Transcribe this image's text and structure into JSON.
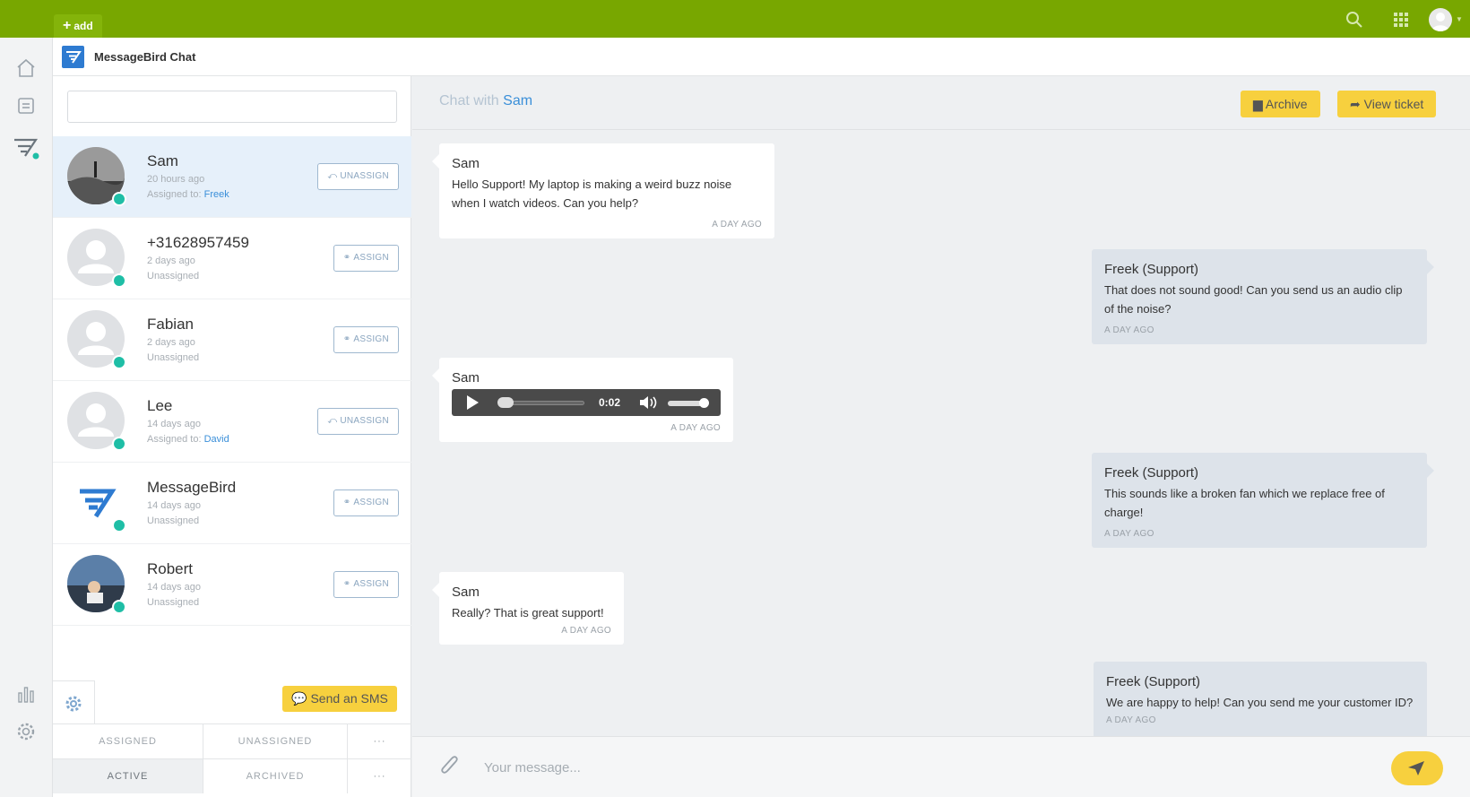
{
  "colors": {
    "topbar": "#78a700",
    "accent_yellow": "#f7d03e",
    "link_blue": "#3a8fd9",
    "online": "#1fbea6"
  },
  "topbar": {
    "add_label": "add",
    "search_icon": "search-icon",
    "apps_icon": "grid-icon",
    "user_icon": "avatar"
  },
  "leftnav": {
    "items": [
      "home-icon",
      "notes-icon",
      "chat-icon",
      "bar-chart-icon",
      "gear-icon"
    ]
  },
  "app": {
    "title": "MessageBird Chat"
  },
  "search": {
    "placeholder": ""
  },
  "conversations": [
    {
      "name": "Sam",
      "time": "20 hours ago",
      "assigned_prefix": "Assigned to:",
      "assigned_to": "Freek",
      "action": "UNASSIGN",
      "active": true
    },
    {
      "name": "+31628957459",
      "time": "2 days ago",
      "assigned_prefix": "Unassigned",
      "assigned_to": "",
      "action": "ASSIGN"
    },
    {
      "name": "Fabian",
      "time": "2 days ago",
      "assigned_prefix": "Unassigned",
      "assigned_to": "",
      "action": "ASSIGN"
    },
    {
      "name": "Lee",
      "time": "14 days ago",
      "assigned_prefix": "Assigned to:",
      "assigned_to": "David",
      "action": "UNASSIGN"
    },
    {
      "name": "MessageBird",
      "time": "14 days ago",
      "assigned_prefix": "Unassigned",
      "assigned_to": "",
      "action": "ASSIGN"
    },
    {
      "name": "Robert",
      "time": "14 days ago",
      "assigned_prefix": "Unassigned",
      "assigned_to": "",
      "action": "ASSIGN"
    }
  ],
  "sidebar_actions": {
    "send_sms": "Send an SMS"
  },
  "filters": {
    "row1": [
      "ASSIGNED",
      "UNASSIGNED",
      "···"
    ],
    "row2": [
      "ACTIVE",
      "ARCHIVED",
      "···"
    ],
    "selected": "ACTIVE"
  },
  "chat": {
    "title_prefix": "Chat with",
    "contact": "Sam",
    "archive_label": "Archive",
    "view_ticket_label": "View ticket",
    "messages": [
      {
        "author": "Sam",
        "text": "Hello Support! My laptop is making a weird buzz noise when I watch videos. Can you help?",
        "time": "A DAY AGO",
        "dir": "in"
      },
      {
        "author": "Freek (Support)",
        "text": "That does not sound good! Can you send us an audio clip of the noise?",
        "time": "A DAY AGO",
        "dir": "out"
      },
      {
        "author": "Sam",
        "audio_time": "0:02",
        "time": "A DAY AGO",
        "dir": "in"
      },
      {
        "author": "Freek (Support)",
        "text": "This sounds like a broken fan which we replace free of charge!",
        "time": "A DAY AGO",
        "dir": "out"
      },
      {
        "author": "Sam",
        "text": "Really? That is great support!",
        "time": "A DAY AGO",
        "dir": "in"
      },
      {
        "author": "Freek (Support)",
        "text": "We are happy to help! Can you send me your customer ID?",
        "time": "A DAY AGO",
        "dir": "out"
      }
    ]
  },
  "composer": {
    "placeholder": "Your message..."
  }
}
